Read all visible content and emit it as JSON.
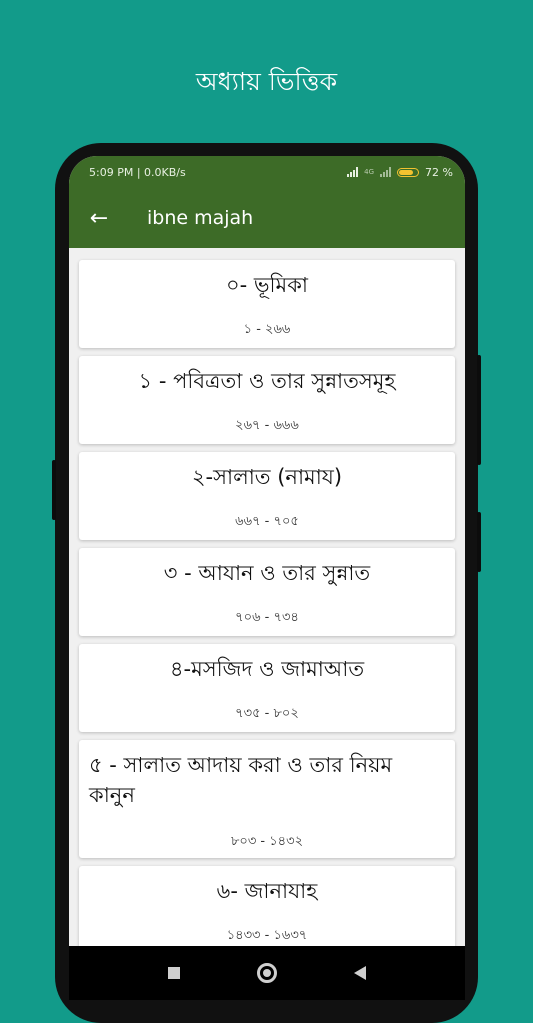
{
  "promo": {
    "title": "অধ্যায় ভিত্তিক"
  },
  "status_bar": {
    "time_speed": "5:09 PM | 0.0KB/s",
    "network": "4G",
    "battery": "72 %"
  },
  "app_bar": {
    "title": "ibne majah"
  },
  "chapters": [
    {
      "title": "০-  ভূমিকা",
      "range": "১ - ২৬৬"
    },
    {
      "title": "১ - পবিত্রতা ও তার সুন্নাতসমূহ",
      "range": "২৬৭ - ৬৬৬"
    },
    {
      "title": "২-সালাত (নামায)",
      "range": "৬৬৭ - ৭০৫"
    },
    {
      "title": "৩ - আযান ও তার সুন্নাত",
      "range": "৭০৬ - ৭৩৪"
    },
    {
      "title": "৪-মসজিদ ও জামাআত",
      "range": "৭৩৫ - ৮০২"
    },
    {
      "title": "৫ - সালাত আদায় করা ও তার নিয়ম কানুন",
      "range": "৮০৩ - ১৪৩২"
    },
    {
      "title": "৬-  জানাযাহ",
      "range": "১৪৩৩ - ১৬৩৭"
    }
  ]
}
